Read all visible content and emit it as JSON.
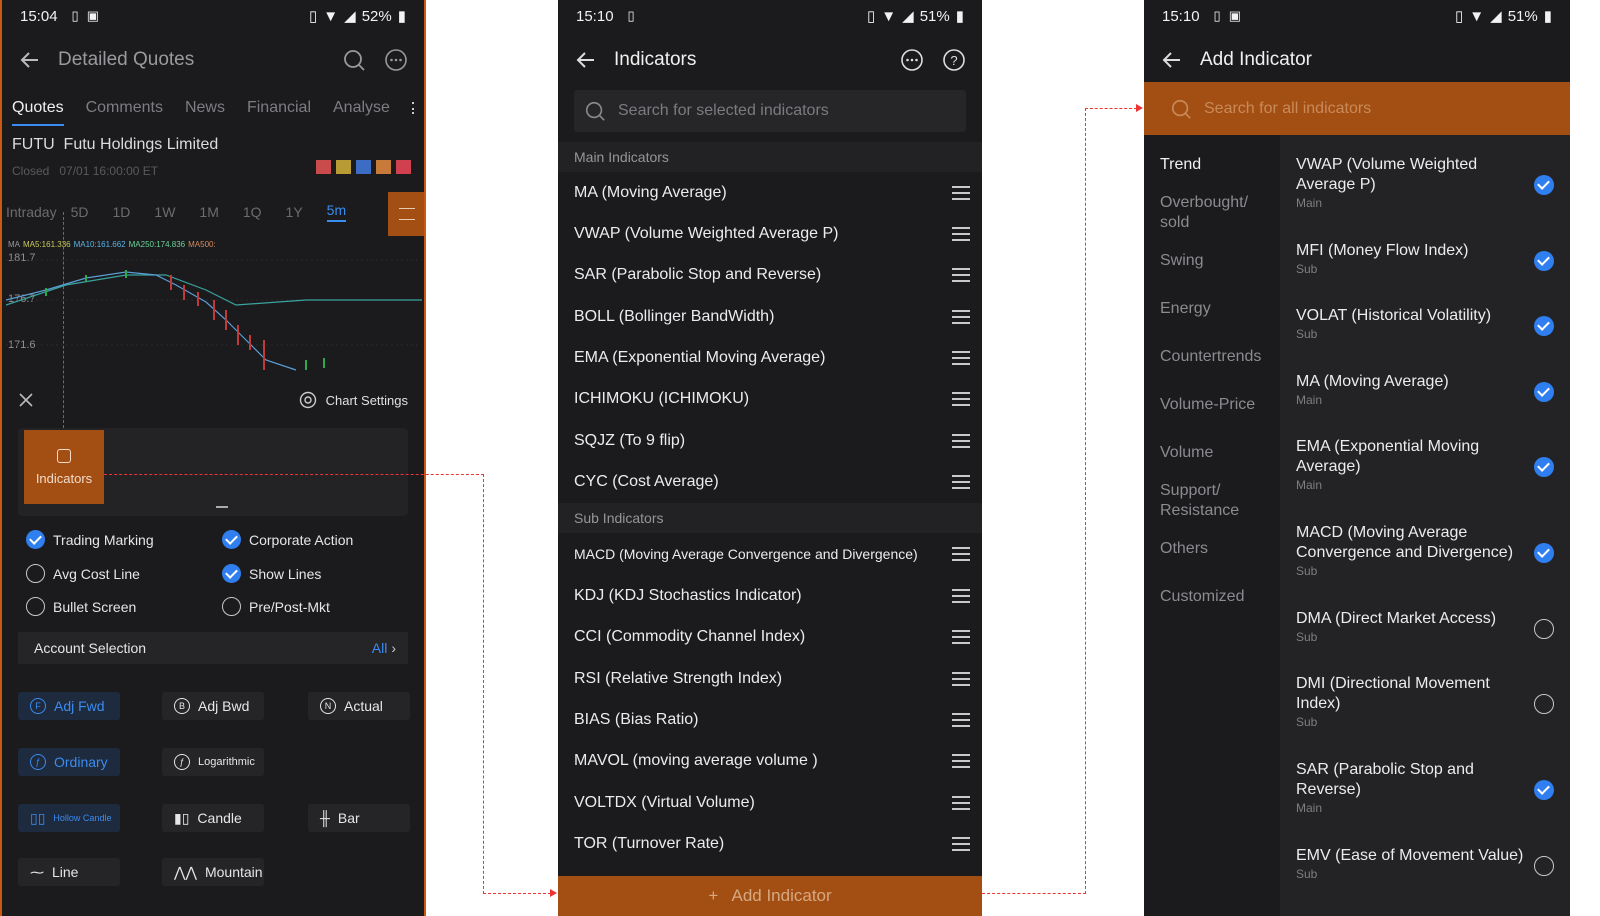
{
  "s1": {
    "time": "15:04",
    "battery": "52%",
    "title": "Detailed Quotes",
    "tabs": [
      "Quotes",
      "Comments",
      "News",
      "Financial",
      "Analyse"
    ],
    "ticker": "FUTU",
    "company": "Futu Holdings Limited",
    "status_line": "Closed   07/01 16:00:00 ET",
    "periods": [
      "Intraday",
      "5D",
      "1D",
      "1W",
      "1M",
      "1Q",
      "1Y",
      "5m"
    ],
    "ma_legend": {
      "ma": "MA",
      "ma5": "MA5:161.336",
      "ma10": "MA10:161.662",
      "ma250": "MA250:174.836",
      "ma500": "MA500:"
    },
    "y_ticks": [
      "181.7",
      "176.7",
      "171.6"
    ],
    "chart_settings": "Chart Settings",
    "indicators_label": "Indicators",
    "options": [
      {
        "label": "Trading Marking",
        "on": true
      },
      {
        "label": "Corporate Action",
        "on": true
      },
      {
        "label": "Avg Cost Line",
        "on": false
      },
      {
        "label": "Show Lines",
        "on": true
      },
      {
        "label": "Bullet Screen",
        "on": false
      },
      {
        "label": "Pre/Post-Mkt",
        "on": false
      }
    ],
    "account_selection": "Account Selection",
    "account_value": "All",
    "adj": [
      "Adj Fwd",
      "Adj Bwd",
      "Actual"
    ],
    "adj_icons": [
      "F",
      "B",
      "N"
    ],
    "scale": [
      "Ordinary",
      "Logarithmic"
    ],
    "styles": [
      "Hollow Candle",
      "Candle",
      "Bar",
      "Line",
      "Mountain"
    ]
  },
  "s2": {
    "time": "15:10",
    "battery": "51%",
    "title": "Indicators",
    "search_placeholder": "Search for selected indicators",
    "main_header": "Main Indicators",
    "main": [
      "MA (Moving Average)",
      "VWAP (Volume Weighted Average P)",
      "SAR (Parabolic Stop and Reverse)",
      "BOLL (Bollinger BandWidth)",
      "EMA (Exponential Moving Average)",
      "ICHIMOKU (ICHIMOKU)",
      "SQJZ (To 9 flip)",
      "CYC (Cost Average)"
    ],
    "sub_header": "Sub Indicators",
    "sub": [
      "MACD (Moving Average Convergence and Divergence)",
      "KDJ (KDJ Stochastics Indicator)",
      "CCI (Commodity Channel Index)",
      "RSI (Relative Strength Index)",
      "BIAS (Bias Ratio)",
      "MAVOL (moving average volume )",
      "VOLTDX (Virtual Volume)",
      "TOR (Turnover Rate)"
    ],
    "add_label": "+   Add Indicator"
  },
  "s3": {
    "time": "15:10",
    "battery": "51%",
    "title": "Add Indicator",
    "search_placeholder": "Search for all indicators",
    "categories": [
      "Trend",
      "Overbought/ sold",
      "Swing",
      "Energy",
      "Countertrends",
      "Volume-Price",
      "Volume",
      "Support/ Resistance",
      "Others",
      "Customized"
    ],
    "items": [
      {
        "name": "VWAP (Volume Weighted Average P)",
        "type": "Main",
        "on": true
      },
      {
        "name": "MFI (Money Flow Index)",
        "type": "Sub",
        "on": true
      },
      {
        "name": "VOLAT (Historical Volatility)",
        "type": "Sub",
        "on": true
      },
      {
        "name": "MA (Moving Average)",
        "type": "Main",
        "on": true
      },
      {
        "name": "EMA (Exponential Moving Average)",
        "type": "Main",
        "on": true
      },
      {
        "name": "MACD (Moving Average Convergence and Divergence)",
        "type": "Sub",
        "on": true
      },
      {
        "name": "DMA (Direct Market Access)",
        "type": "Sub",
        "on": false
      },
      {
        "name": "DMI (Directional Movement Index)",
        "type": "Sub",
        "on": false
      },
      {
        "name": "SAR (Parabolic Stop and Reverse)",
        "type": "Main",
        "on": true
      },
      {
        "name": "EMV (Ease of Movement Value)",
        "type": "Sub",
        "on": false
      }
    ]
  },
  "colors": {
    "accent": "#3b8cf0",
    "orange": "#a34f13",
    "arrow": "#e33333",
    "bg": "#1b1b1d"
  }
}
